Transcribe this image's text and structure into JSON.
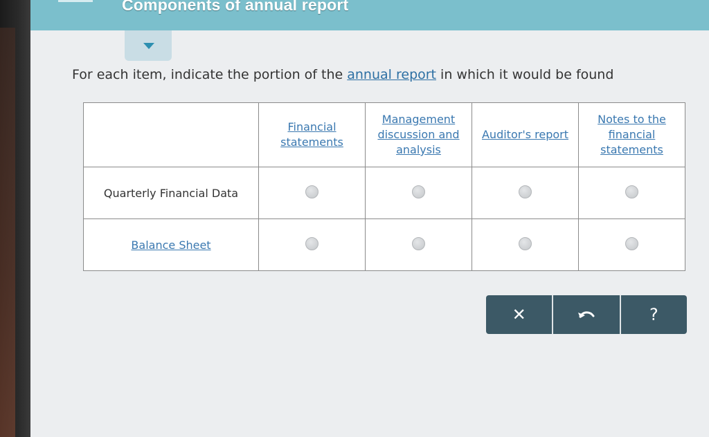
{
  "header": {
    "title": "Components of annual report"
  },
  "instruction": {
    "before": "For each item, indicate the portion of the ",
    "link": "annual report",
    "after": " in which it would be found"
  },
  "table": {
    "columns": [
      "Financial statements",
      "Management discussion and analysis",
      "Auditor's report",
      "Notes to the financial statements"
    ],
    "rows": [
      {
        "label": "Quarterly Financial Data",
        "linked": false
      },
      {
        "label": "Balance Sheet",
        "linked": true
      }
    ]
  },
  "toolbar": {
    "clear_label": "✕",
    "undo_icon": "undo-icon",
    "help_label": "?"
  },
  "colors": {
    "header": "#7bbfcc",
    "link": "#3a78b0",
    "toolbar": "#3c5966"
  }
}
